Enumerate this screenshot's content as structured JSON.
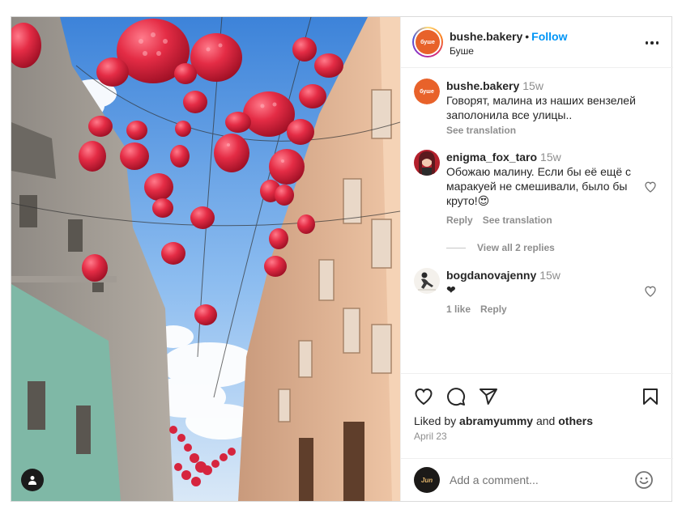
{
  "post": {
    "author": {
      "username": "bushe.bakery",
      "subtitle": "Буше",
      "follow_label": "Follow",
      "separator": "•",
      "avatar_text": "буше"
    },
    "caption": {
      "username": "bushe.bakery",
      "time": "15w",
      "text": "Говорят, малина из наших вензелей заполонила все улицы..",
      "see_translation": "See translation"
    },
    "comments": [
      {
        "username": "enigma_fox_taro",
        "time": "15w",
        "text": "Обожаю малину. Если бы её ещё с маракуей не смешивали, было бы круто!😍",
        "reply_label": "Reply",
        "see_translation": "See translation",
        "view_replies": "View all 2 replies"
      },
      {
        "username": "bogdanovajenny",
        "time": "15w",
        "text": "❤",
        "likes_label": "1 like",
        "reply_label": "Reply"
      }
    ],
    "likes": {
      "prefix": "Liked by",
      "user": "abramyummy",
      "conjunction": "and",
      "others": "others"
    },
    "date": "April 23",
    "add_comment": {
      "placeholder": "Add a comment...",
      "my_avatar_text": "Jun"
    },
    "icons": {
      "more": "more-options-icon",
      "like": "heart-icon",
      "comment": "comment-bubble-icon",
      "share": "paper-plane-icon",
      "save": "bookmark-icon",
      "emoji": "emoji-icon",
      "tagged_user": "user-tag-icon"
    },
    "colors": {
      "accent": "#0095f6",
      "muted": "#8e8e8e",
      "text": "#262626",
      "border": "#dbdbdb"
    }
  }
}
